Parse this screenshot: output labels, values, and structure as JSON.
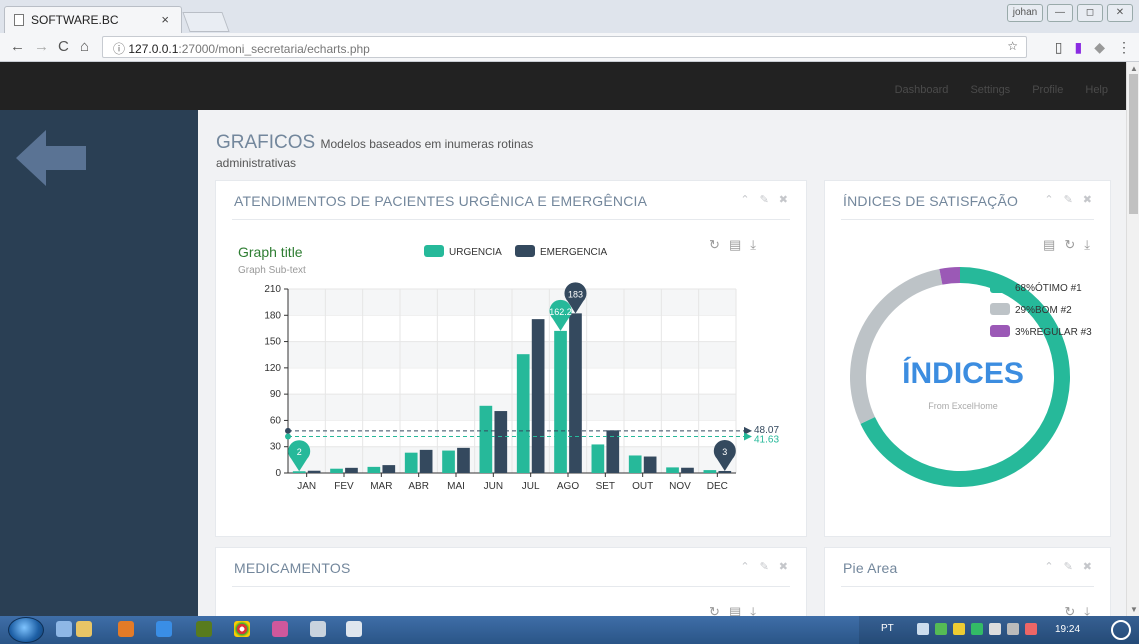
{
  "browser": {
    "tab_title": "SOFTWARE.BC",
    "url_host": "127.0.0.1",
    "url_path": ":27000/moni_secretaria/echarts.php",
    "profile": "johan"
  },
  "navbar": {
    "links": [
      "Dashboard",
      "Settings",
      "Profile",
      "Help"
    ]
  },
  "page": {
    "title": "GRAFICOS",
    "subtitle": "Modelos baseados em inumeras rotinas",
    "subtitle2": "administrativas"
  },
  "panels": {
    "attendances": {
      "title": "ATENDIMENTOS DE PACIENTES URGÊNICA E EMERGÊNCIA"
    },
    "satisfaction": {
      "title": "ÍNDICES DE SATISFAÇÃO"
    },
    "medicines": {
      "title": "MEDICAMENTOS"
    },
    "pie_area": {
      "title": "Pie Area"
    }
  },
  "taskbar": {
    "lang": "PT",
    "clock": "19:24"
  },
  "chart_data": [
    {
      "type": "bar",
      "title": "Graph title",
      "subtitle": "Graph Sub-text",
      "categories": [
        "JAN",
        "FEV",
        "MAR",
        "ABR",
        "MAI",
        "JUN",
        "JUL",
        "AGO",
        "SET",
        "OUT",
        "NOV",
        "DEC"
      ],
      "series": [
        {
          "name": "URGENCIA",
          "color": "#26b99a",
          "values": [
            2,
            4.9,
            7,
            23.2,
            25.6,
            76.7,
            135.6,
            162.2,
            32.6,
            20,
            6.4,
            3.3
          ]
        },
        {
          "name": "EMERGENCIA",
          "color": "#34495e",
          "values": [
            2.6,
            5.9,
            9,
            26.4,
            28.7,
            70.7,
            175.6,
            182.2,
            48.7,
            18.8,
            6,
            2.3
          ]
        }
      ],
      "ylim": [
        0,
        210
      ],
      "yticks": [
        0,
        30,
        60,
        90,
        120,
        150,
        180,
        210
      ],
      "legend": "top",
      "mark_points": [
        {
          "series": "URGENCIA",
          "label": "162.2",
          "category": "AGO"
        },
        {
          "series": "URGENCIA",
          "label": "2",
          "category": "JAN"
        },
        {
          "series": "EMERGENCIA",
          "label": "183",
          "category": "AGO"
        },
        {
          "series": "EMERGENCIA",
          "label": "3",
          "category": "DEC"
        }
      ],
      "mark_lines": [
        {
          "series": "EMERGENCIA",
          "label": "48.07",
          "value": 48.07
        },
        {
          "series": "URGENCIA",
          "label": "41.63",
          "value": 41.63
        }
      ]
    },
    {
      "type": "pie",
      "title": "ÍNDICES",
      "subtitle": "From ExcelHome",
      "legend": "top-right",
      "series": [
        {
          "name": "68%ÓTIMO #1",
          "value": 68,
          "color": "#26b99a"
        },
        {
          "name": "29%BOM #2",
          "value": 29,
          "color": "#bdc3c7"
        },
        {
          "name": "3%REGULAR #3",
          "value": 3,
          "color": "#9b59b6"
        }
      ]
    }
  ]
}
